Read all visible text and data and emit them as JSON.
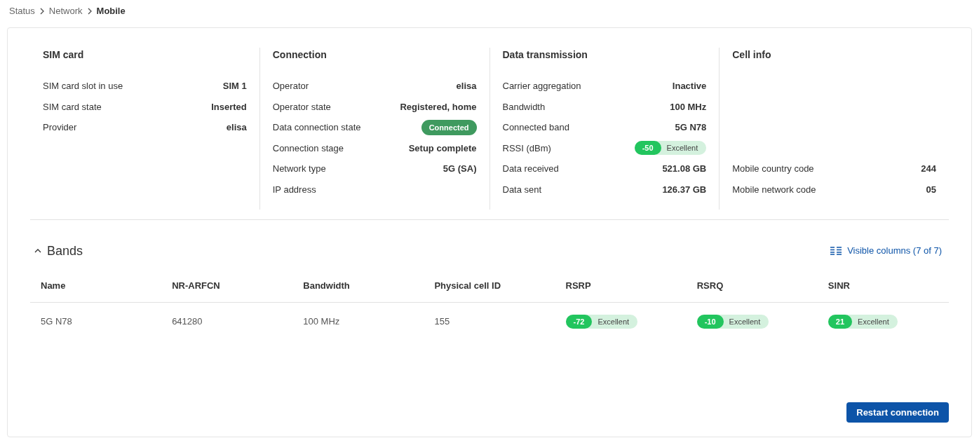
{
  "breadcrumb": [
    {
      "label": "Status",
      "current": false
    },
    {
      "label": "Network",
      "current": false
    },
    {
      "label": "Mobile",
      "current": true
    }
  ],
  "sections": [
    {
      "title": "SIM card",
      "rows": [
        {
          "label": "SIM card slot in use",
          "kind": "text",
          "value": "SIM 1"
        },
        {
          "label": "SIM card state",
          "kind": "text",
          "value": "Inserted"
        },
        {
          "label": "Provider",
          "kind": "text",
          "value": "elisa"
        }
      ]
    },
    {
      "title": "Connection",
      "rows": [
        {
          "label": "Operator",
          "kind": "text",
          "value": "elisa"
        },
        {
          "label": "Operator state",
          "kind": "text",
          "value": "Registered, home"
        },
        {
          "label": "Data connection state",
          "kind": "status",
          "value": "Connected"
        },
        {
          "label": "Connection stage",
          "kind": "text",
          "value": "Setup complete"
        },
        {
          "label": "Network type",
          "kind": "text",
          "value": "5G (SA)"
        },
        {
          "label": "IP address",
          "kind": "text"
        }
      ]
    },
    {
      "title": "Data transmission",
      "rows": [
        {
          "label": "Carrier aggregation",
          "kind": "text",
          "value": "Inactive"
        },
        {
          "label": "Bandwidth",
          "kind": "text",
          "value": "100 MHz"
        },
        {
          "label": "Connected band",
          "kind": "text",
          "value": "5G N78"
        },
        {
          "label": "RSSI (dBm)",
          "kind": "signal",
          "value": "-50",
          "quality": "Excellent"
        },
        {
          "label": "Data received",
          "kind": "text",
          "value": "521.08 GB"
        },
        {
          "label": "Data sent",
          "kind": "text",
          "value": "126.37 GB"
        }
      ]
    },
    {
      "title": "Cell info",
      "rows": [
        {
          "label": "Mobile country code",
          "kind": "text",
          "value": "244"
        },
        {
          "label": "Mobile network code",
          "kind": "text",
          "value": "05"
        }
      ]
    }
  ],
  "bands": {
    "title": "Bands",
    "expanded": true,
    "visible_columns": "Visible columns (7 of 7)",
    "columns": [
      "Name",
      "NR-ARFCN",
      "Bandwidth",
      "Physical cell ID",
      "RSRP",
      "RSRQ",
      "SINR"
    ],
    "rows": [
      [
        {
          "kind": "text",
          "value": "5G N78"
        },
        {
          "kind": "text",
          "value": "641280"
        },
        {
          "kind": "text",
          "value": "100 MHz"
        },
        {
          "kind": "text",
          "value": "155"
        },
        {
          "kind": "signal",
          "value": "-72",
          "quality": "Excellent"
        },
        {
          "kind": "signal",
          "value": "-10",
          "quality": "Excellent"
        },
        {
          "kind": "signal",
          "value": "21",
          "quality": "Excellent"
        }
      ]
    ]
  },
  "restart_button": "Restart connection"
}
